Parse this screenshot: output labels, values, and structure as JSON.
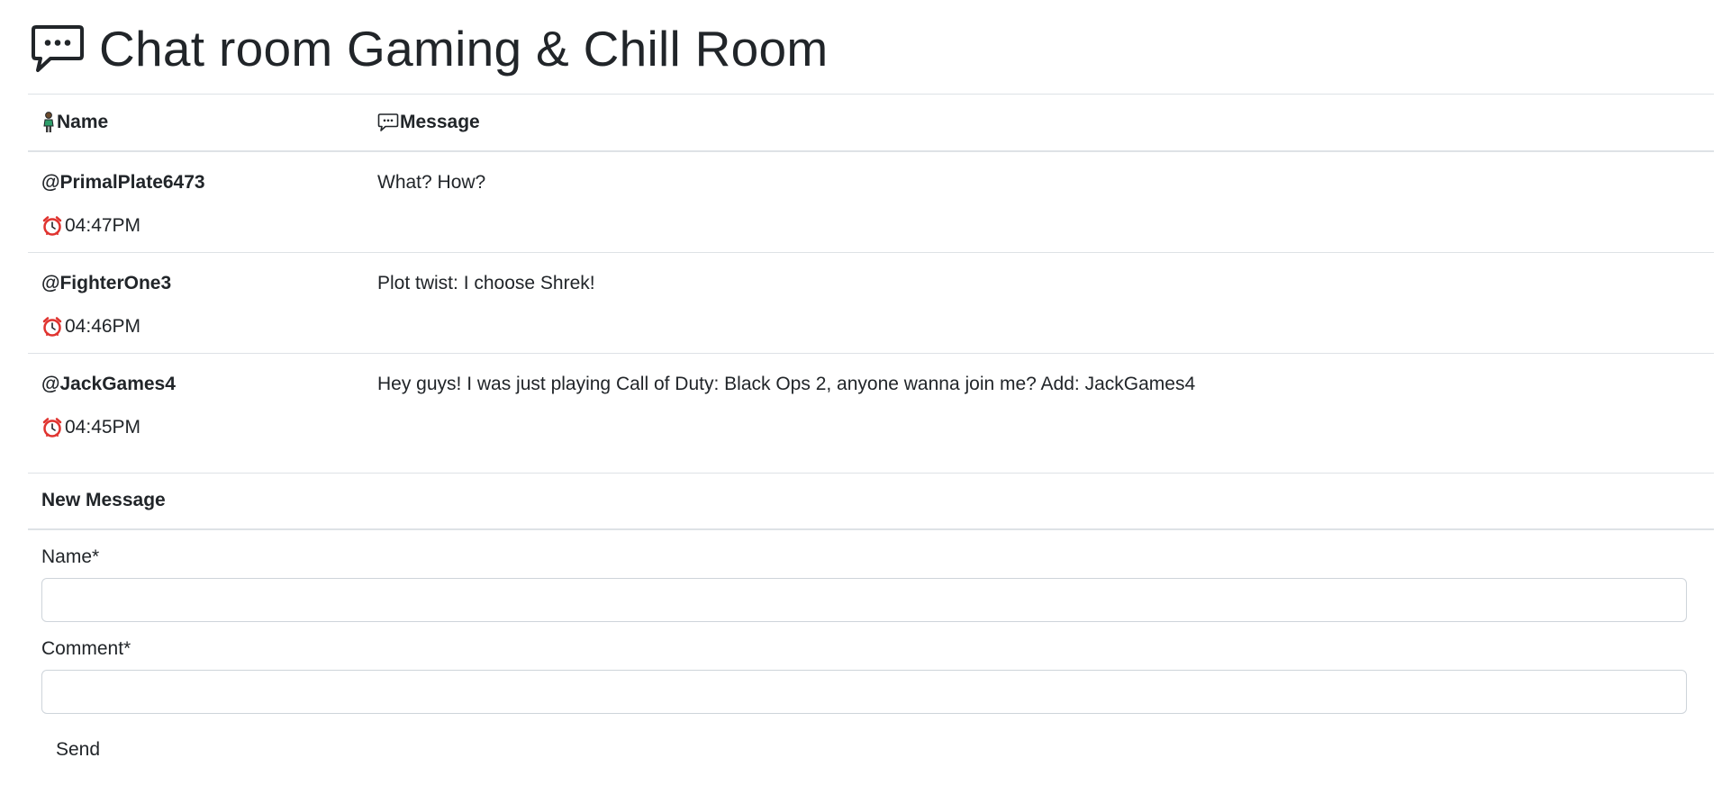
{
  "header": {
    "icon": "speech-bubble-icon",
    "title": "Chat room Gaming & Chill Room"
  },
  "table": {
    "columns": [
      {
        "icon": "person-icon",
        "label": "Name"
      },
      {
        "icon": "speech-bubble-icon",
        "label": "Message"
      }
    ],
    "rows": [
      {
        "author": "@PrimalPlate6473",
        "time_icon": "alarm-clock-icon",
        "time": "04:47PM",
        "message": "What? How?"
      },
      {
        "author": "@FighterOne3",
        "time_icon": "alarm-clock-icon",
        "time": "04:46PM",
        "message": "Plot twist: I choose Shrek!"
      },
      {
        "author": "@JackGames4",
        "time_icon": "alarm-clock-icon",
        "time": "04:45PM",
        "message": "Hey guys! I was just playing Call of Duty: Black Ops 2, anyone wanna join me? Add: JackGames4"
      }
    ]
  },
  "new_message": {
    "heading": "New Message",
    "name_label": "Name*",
    "name_value": "",
    "comment_label": "Comment*",
    "comment_value": "",
    "send_label": "Send"
  },
  "colors": {
    "text": "#212529",
    "border": "#dee2e6",
    "alarm_red": "#e0332f",
    "person_green": "#2e9e6a"
  }
}
